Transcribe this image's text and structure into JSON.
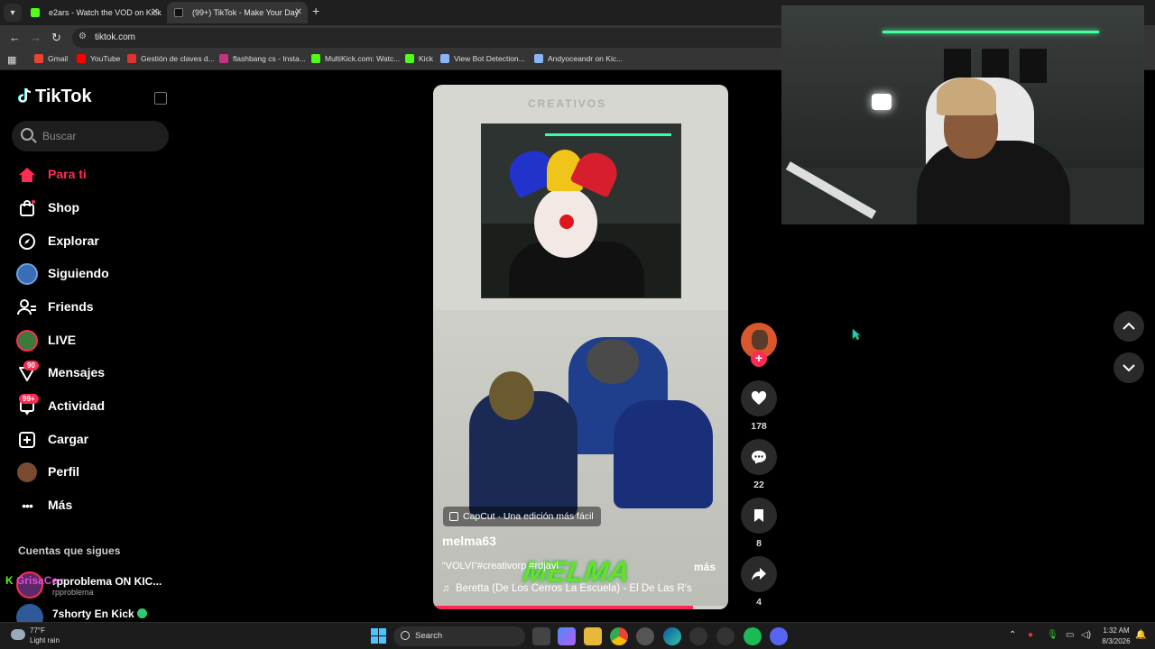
{
  "browser": {
    "tabs": [
      {
        "title": "e2ars - Watch the VOD on Kick",
        "favicon_color": "#53fc18",
        "active": false
      },
      {
        "title": "(99+) TikTok - Make Your Day",
        "favicon_color": "#111111",
        "active": true
      }
    ],
    "url": "tiktok.com",
    "bookmarks": [
      {
        "label": "Gmail",
        "icon_color": "#ea4335"
      },
      {
        "label": "YouTube",
        "icon_color": "#ff0000"
      },
      {
        "label": "Gestión de claves d...",
        "icon_color": "#d33"
      },
      {
        "label": "flashbang cs - Insta...",
        "icon_color": "#c13584"
      },
      {
        "label": "MultiKick.com: Watc...",
        "icon_color": "#53fc18"
      },
      {
        "label": "Kick",
        "icon_color": "#53fc18"
      },
      {
        "label": "View Bot Detection...",
        "icon_color": "#8ab4f8"
      },
      {
        "label": "Andyoceandr on Kic...",
        "icon_color": "#8ab4f8"
      }
    ]
  },
  "tiktok": {
    "logo": "TikTok",
    "search_placeholder": "Buscar",
    "nav": [
      {
        "label": "Para ti",
        "icon": "home-icon",
        "active": true
      },
      {
        "label": "Shop",
        "icon": "shop-bag-icon",
        "active": false
      },
      {
        "label": "Explorar",
        "icon": "compass-icon",
        "active": false
      },
      {
        "label": "Siguiendo",
        "icon": "following-avatar-icon",
        "active": false
      },
      {
        "label": "Friends",
        "icon": "friends-icon",
        "active": false
      },
      {
        "label": "LIVE",
        "icon": "live-avatar-icon",
        "active": false
      },
      {
        "label": "Mensajes",
        "icon": "messages-icon",
        "active": false,
        "badge": "90"
      },
      {
        "label": "Actividad",
        "icon": "activity-icon",
        "active": false,
        "badge": "99+"
      },
      {
        "label": "Cargar",
        "icon": "upload-icon",
        "active": false
      },
      {
        "label": "Perfil",
        "icon": "profile-avatar-icon",
        "active": false
      },
      {
        "label": "Más",
        "icon": "more-icon",
        "active": false
      }
    ],
    "following_title": "Cuentas que sigues",
    "following": [
      {
        "name": "rpproblema ON KIC...",
        "sub": "rpproblema"
      },
      {
        "name": "7shorty En Kick",
        "sub": ""
      }
    ],
    "video": {
      "watermark": "CREATIVOS",
      "capcut_chip": "CapCut · Una edición más fácil",
      "username": "melma63",
      "description": "“VOLVI”#creativorp #rdjavi",
      "more": "más",
      "music": "Beretta (De Los Cerros La Escuela) - El De Las R's",
      "overlay_text": "MELMA",
      "progress": 0.88
    },
    "actions": {
      "likes": "178",
      "comments": "22",
      "saves": "8",
      "shares": "4"
    }
  },
  "chat_overlay": {
    "user": "GrisaCe",
    "sep": ":"
  },
  "taskbar": {
    "weather_temp": "77°F",
    "weather_desc": "Light rain",
    "search": "Search",
    "time": "1:32 AM",
    "date": "8/3/2026"
  },
  "colors": {
    "accent": "#fe2c55",
    "kick_green": "#53fc18"
  }
}
